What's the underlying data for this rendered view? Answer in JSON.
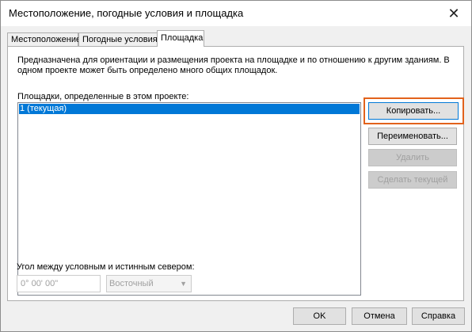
{
  "window": {
    "title": "Местоположение, погодные условия и площадка",
    "close_glyph": "✕"
  },
  "tabs": [
    {
      "label": "Местоположение",
      "active": false
    },
    {
      "label": "Погодные условия",
      "active": false
    },
    {
      "label": "Площадка",
      "active": true
    }
  ],
  "site_tab": {
    "description": "Предназначена для ориентации и размещения проекта на площадке и по отношению к другим зданиям. В одном проекте может быть определено много общих площадок.",
    "list_label": "Площадки, определенные в этом проекте:",
    "sites": [
      {
        "label": "1 (текущая)",
        "selected": true
      }
    ],
    "buttons": {
      "duplicate": "Копировать...",
      "rename": "Переименовать...",
      "delete": "Удалить",
      "make_current": "Сделать текущей"
    },
    "angle_label": "Угол между условным и истинным севером:",
    "angle_value": "0° 00' 00\"",
    "direction_value": "Восточный"
  },
  "footer": {
    "ok": "OK",
    "cancel": "Отмена",
    "help": "Справка"
  },
  "colors": {
    "selection": "#0078d7",
    "highlight_box": "#e2621c"
  }
}
